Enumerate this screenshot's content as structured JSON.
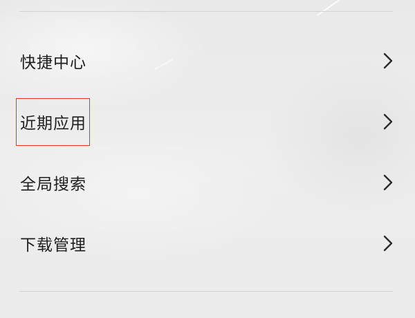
{
  "menu": {
    "items": [
      {
        "label": "快捷中心",
        "icon": "chevron-right-icon"
      },
      {
        "label": "近期应用",
        "icon": "chevron-right-icon"
      },
      {
        "label": "全局搜索",
        "icon": "chevron-right-icon"
      },
      {
        "label": "下载管理",
        "icon": "chevron-right-icon"
      }
    ]
  },
  "annotation": {
    "highlight_color": "#e0342c",
    "highlighted_item": "近期应用"
  }
}
